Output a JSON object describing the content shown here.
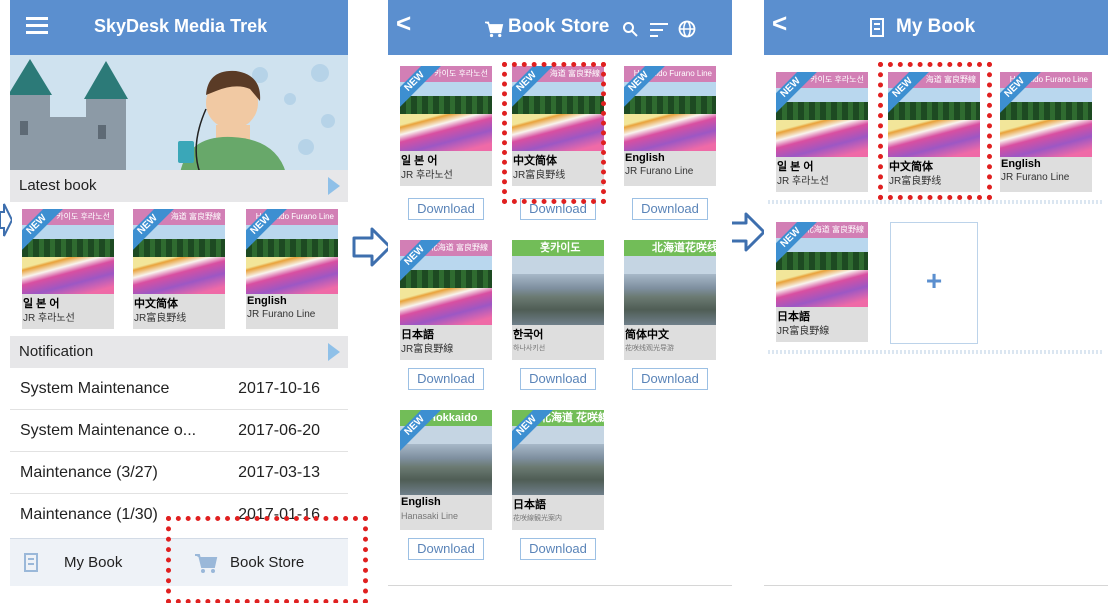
{
  "screen1": {
    "title": "SkyDesk Media Trek",
    "latest_label": "Latest book",
    "notification_label": "Notification",
    "badge": "NEW",
    "books": [
      {
        "band": "카이도 후라노선",
        "name": "일 본 어",
        "sub": "JR 후라노선"
      },
      {
        "band": "海道 富良野線",
        "name": "中文简体",
        "sub": "JR富良野线"
      },
      {
        "band": "Hokkaido Furano Line",
        "name": "English",
        "sub": "JR  Furano  Line"
      }
    ],
    "notifications": [
      {
        "title": "System Maintenance",
        "date": "2017-10-16"
      },
      {
        "title": "System Maintenance o...",
        "date": "2017-06-20"
      },
      {
        "title": "Maintenance (3/27)",
        "date": "2017-03-13"
      },
      {
        "title": "Maintenance (1/30)",
        "date": "2017-01-16"
      }
    ],
    "tabs": {
      "my_book": "My Book",
      "book_store": "Book Store"
    }
  },
  "screen2": {
    "title": "Book Store",
    "download_label": "Download",
    "badge": "NEW",
    "books": [
      {
        "band": "카이도 후라노선",
        "name": "일 본 어",
        "sub": "JR 후라노선"
      },
      {
        "band": "海道 富良野線",
        "name": "中文简体",
        "sub": "JR富良野线"
      },
      {
        "band": "Hokkaido Furano Line",
        "name": "English",
        "sub": "JR  Furano  Line"
      },
      {
        "band": "北海道 富良野線",
        "name": "日本語",
        "sub": "JR富良野線"
      },
      {
        "band": "홋카이도",
        "name": "한국어",
        "sub": "하나사키선"
      },
      {
        "band": "北海道花咲线",
        "name": "简体中文",
        "sub": "花咲线观光导游"
      },
      {
        "band": "Hokkaido",
        "name": "English",
        "sub": "Hanasaki Line"
      },
      {
        "band": "北海道 花咲線",
        "name": "日本語",
        "sub": "花咲線観光案内"
      }
    ]
  },
  "screen3": {
    "title": "My Book",
    "add_label": "+",
    "badge": "NEW",
    "books": [
      {
        "band": "카이도 후라노선",
        "name": "일 본 어",
        "sub": "JR 후라노선"
      },
      {
        "band": "海道 富良野線",
        "name": "中文简体",
        "sub": "JR富良野线"
      },
      {
        "band": "Hokkaido Furano Line",
        "name": "English",
        "sub": "JR  Furano  Line"
      },
      {
        "band": "北海道 富良野線",
        "name": "日本語",
        "sub": "JR富良野線"
      }
    ]
  },
  "colors": {
    "header": "#5b8fcf",
    "highlight": "#e02020",
    "badge": "#3d8fd1"
  }
}
